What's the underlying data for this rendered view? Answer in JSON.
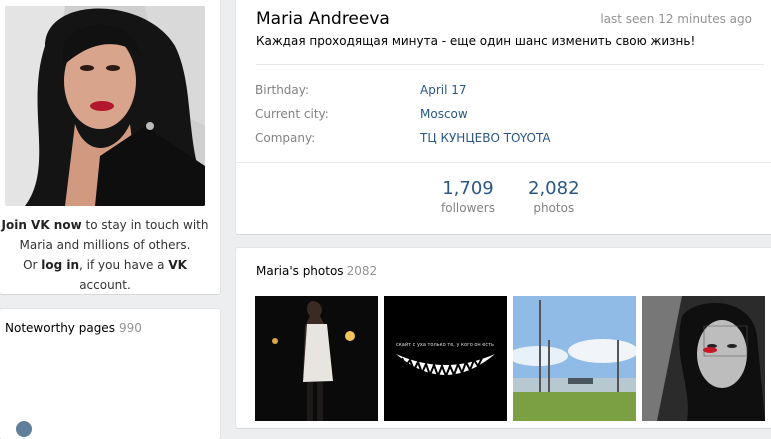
{
  "left": {
    "join_strong": "Join VK now",
    "join_rest": " to stay in touch with",
    "join_line2": "Maria and millions of others.",
    "join_line3_a": "Or ",
    "join_login": "log in",
    "join_line3_b": ", if you have a ",
    "join_vk": "VK",
    "join_line3_c": " account."
  },
  "noteworthy": {
    "title": "Noteworthy pages",
    "count": "990"
  },
  "profile": {
    "name": "Maria Andreeva",
    "last_seen": "last seen 12 minutes ago",
    "status": "Каждая проходящая минута - еще один шанс изменить свою жизнь!",
    "info": [
      {
        "label": "Birthday:",
        "value": "April 17"
      },
      {
        "label": "Current city:",
        "value": "Moscow"
      },
      {
        "label": "Company:",
        "value": "ТЦ КУНЦЕВО TOYOTA"
      }
    ],
    "counters": [
      {
        "number": "1,709",
        "label": "followers"
      },
      {
        "number": "2,082",
        "label": "photos"
      }
    ]
  },
  "photos": {
    "title": "Maria's photos",
    "count": "2082",
    "thumb_caption": "скайт с уха только те, у кого он есть"
  },
  "colors": {
    "link": "#2a5885",
    "muted": "#828282",
    "background": "#edeef0"
  }
}
